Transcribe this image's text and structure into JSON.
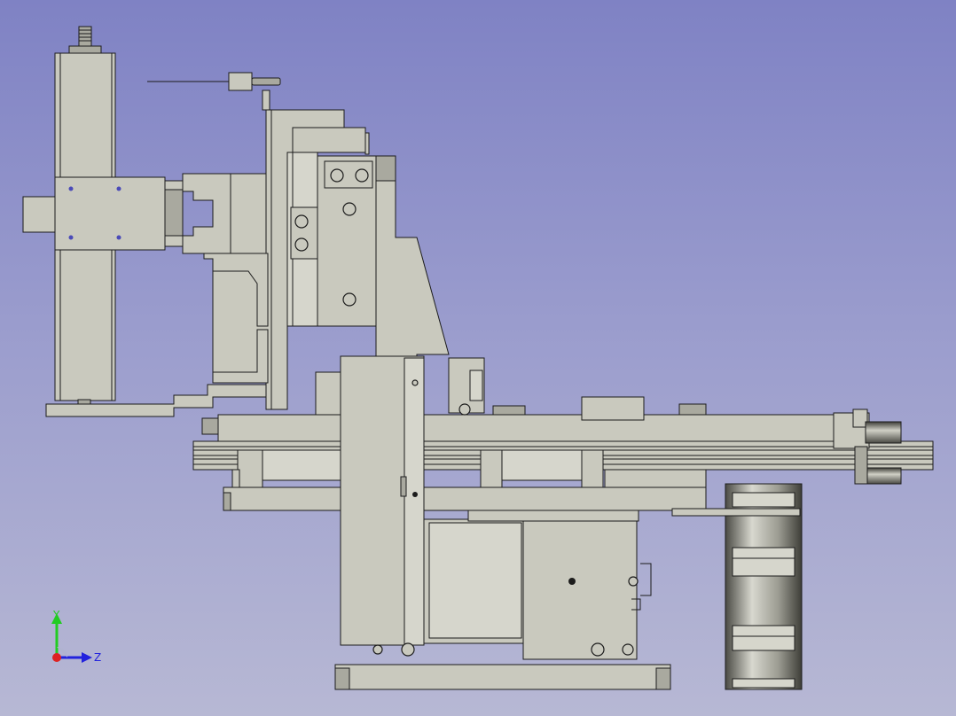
{
  "axes": {
    "y_label": "Y",
    "z_label": "Z",
    "y_color": "#22cc22",
    "z_color": "#2222dd",
    "x_color": "#dd2222"
  },
  "colors": {
    "background_top": "#7f82c4",
    "background_bottom": "#b7b8d4",
    "part_fill": "#c9c9be",
    "edge": "#1c1c1c"
  }
}
